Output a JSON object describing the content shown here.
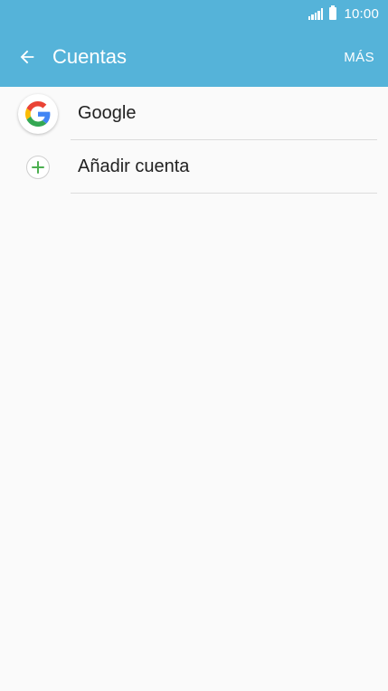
{
  "status_bar": {
    "time": "10:00"
  },
  "app_bar": {
    "title": "Cuentas",
    "more_label": "MÁS"
  },
  "accounts": [
    {
      "label": "Google",
      "icon": "google-logo-icon"
    },
    {
      "label": "Añadir cuenta",
      "icon": "plus-icon"
    }
  ],
  "colors": {
    "header": "#55b3d9",
    "background": "#fafafa",
    "plus": "#4caf50"
  }
}
